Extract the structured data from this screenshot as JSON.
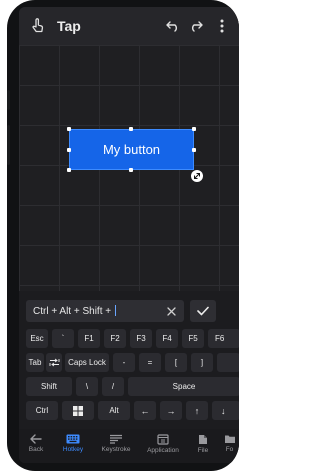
{
  "colors": {
    "accent": "#1565e8",
    "active_nav": "#3d8bff",
    "background": "#202023",
    "key_background": "#2b2b30"
  },
  "appbar": {
    "title": "Tap",
    "icons": [
      "touch-icon",
      "undo-icon",
      "redo-icon",
      "more-vert-icon"
    ]
  },
  "canvas": {
    "button_label": "My button"
  },
  "shortcut_input": {
    "value": "Ctrl + Alt + Shift + "
  },
  "keyboard": {
    "row1": [
      "Esc",
      "`",
      "F1",
      "F2",
      "F3",
      "F4",
      "F5",
      "F6"
    ],
    "row2": [
      "Tab",
      "",
      "Caps Lock",
      "-",
      "=",
      "[",
      "]"
    ],
    "row3": [
      "Shift",
      "\\",
      "/",
      "Space"
    ],
    "row4": [
      "Ctrl",
      "",
      "Alt",
      "←",
      "→",
      "↑",
      "↓"
    ]
  },
  "bottom_nav": {
    "items": [
      {
        "label": "Back",
        "icon": "arrow-back-icon"
      },
      {
        "label": "Hotkey",
        "icon": "keyboard-icon",
        "active": true
      },
      {
        "label": "Keystroke",
        "icon": "keystroke-icon"
      },
      {
        "label": "Application",
        "icon": "application-icon"
      },
      {
        "label": "File",
        "icon": "file-icon"
      },
      {
        "label": "Fo",
        "icon": "folder-icon"
      }
    ]
  }
}
